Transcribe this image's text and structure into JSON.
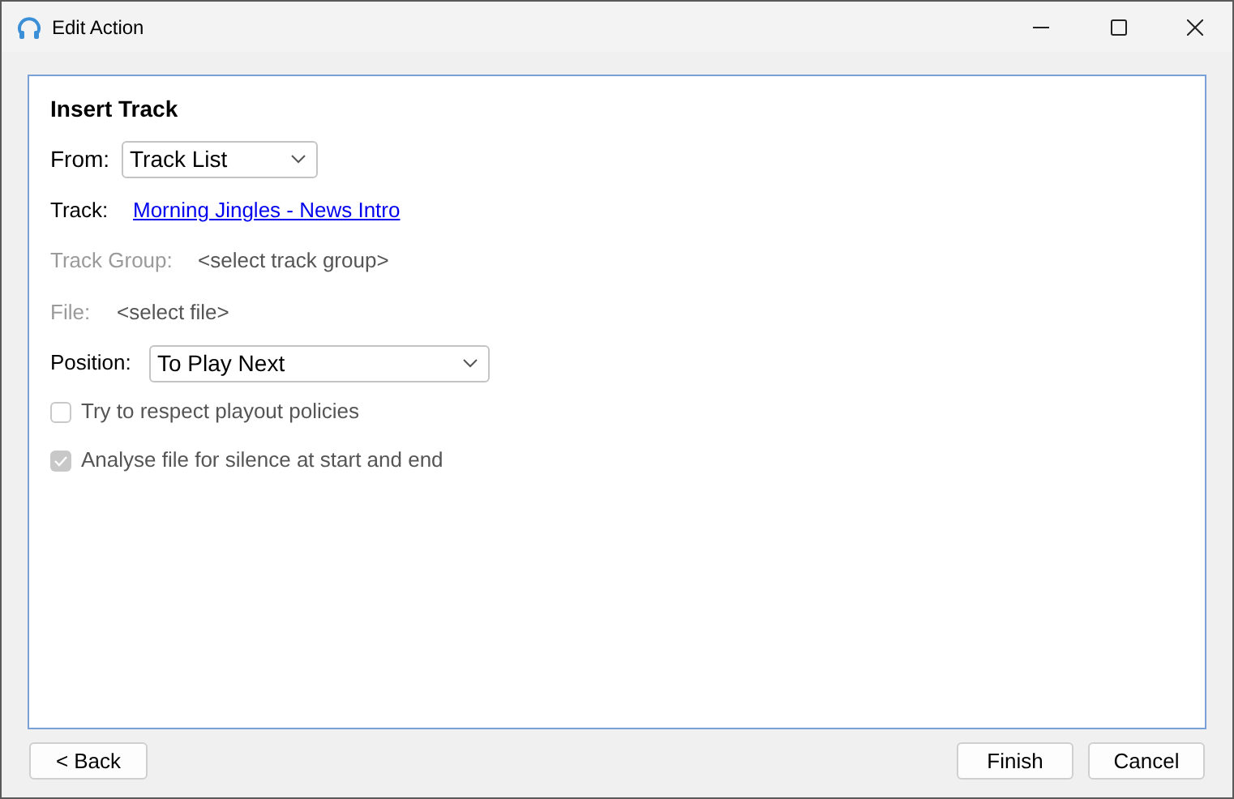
{
  "window": {
    "title": "Edit Action"
  },
  "panel": {
    "heading": "Insert Track",
    "from": {
      "label": "From:",
      "value": "Track List"
    },
    "track": {
      "label": "Track:",
      "link": "Morning Jingles - News Intro"
    },
    "track_group": {
      "label": "Track Group:",
      "value": "<select track group>",
      "disabled": true
    },
    "file": {
      "label": "File:",
      "value": "<select file>",
      "disabled": true
    },
    "position": {
      "label": "Position:",
      "value": "To Play Next"
    },
    "checkboxes": [
      {
        "label": "Try to respect playout policies",
        "checked": false,
        "disabled": true
      },
      {
        "label": "Analyse file for silence at start and end",
        "checked": true,
        "disabled": true
      }
    ]
  },
  "buttons": {
    "back": "< Back",
    "finish": "Finish",
    "cancel": "Cancel"
  }
}
